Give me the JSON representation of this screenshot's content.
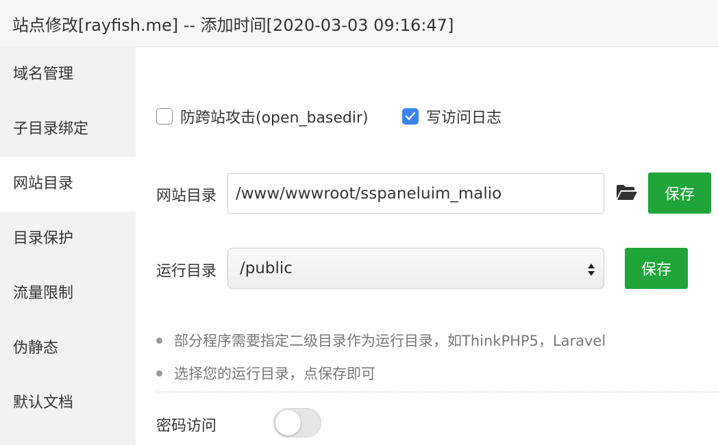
{
  "window": {
    "title": "站点修改[rayfish.me] -- 添加时间[2020-03-03 09:16:47]"
  },
  "sidebar": {
    "items": [
      {
        "label": "域名管理"
      },
      {
        "label": "子目录绑定"
      },
      {
        "label": "网站目录",
        "active": true
      },
      {
        "label": "目录保护"
      },
      {
        "label": "流量限制"
      },
      {
        "label": "伪静态"
      },
      {
        "label": "默认文档"
      }
    ]
  },
  "options": {
    "anti_xss": {
      "label": "防跨站攻击(open_basedir)",
      "checked": false
    },
    "write_log": {
      "label": "写访问日志",
      "checked": true
    }
  },
  "site_dir": {
    "label": "网站目录",
    "value": "/www/wwwroot/sspaneluim_malio",
    "save_label": "保存",
    "icon": "folder-open-icon"
  },
  "run_dir": {
    "label": "运行目录",
    "selected": "/public",
    "save_label": "保存"
  },
  "tips": [
    "部分程序需要指定二级目录作为运行目录，如ThinkPHP5，Laravel",
    "选择您的运行目录，点保存即可"
  ],
  "password_access": {
    "label": "密码访问",
    "enabled": false
  },
  "colors": {
    "accent": "#20a53a",
    "checkbox": "#3b84f0",
    "header_bg": "#f6f6f6",
    "sidebar_bg": "#f2f2f2"
  }
}
